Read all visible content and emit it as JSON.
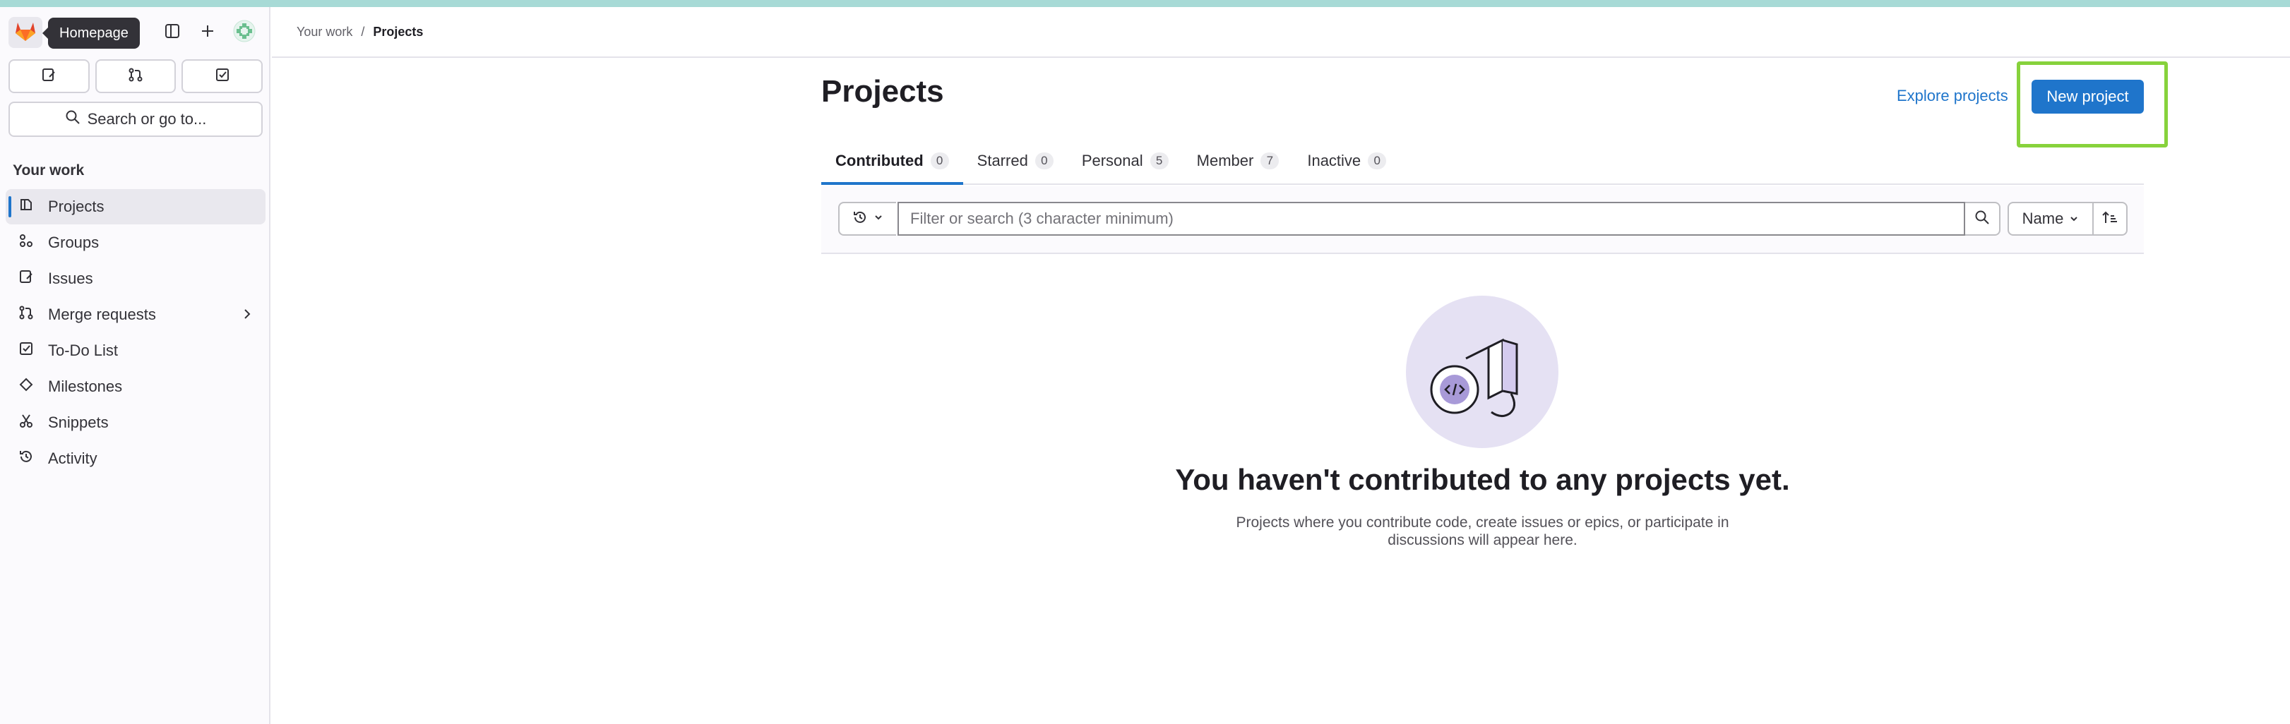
{
  "colors": {
    "accent": "#1f75cb",
    "highlight": "#87d23c",
    "top_strip": "#a7dad6",
    "illustration_bg": "#e5e1f3"
  },
  "sidebar": {
    "logo_icon": "gitlab-tanuki-icon",
    "tooltip": "Homepage",
    "top_icons": [
      "sidebar-toggle-icon",
      "plus-icon",
      "user-avatar-icon"
    ],
    "quick_actions": [
      "issues-icon",
      "merge-request-icon",
      "todo-icon"
    ],
    "search_label": "Search or go to...",
    "section_title": "Your work",
    "items": [
      {
        "label": "Projects",
        "icon": "project-icon",
        "active": true
      },
      {
        "label": "Groups",
        "icon": "group-icon"
      },
      {
        "label": "Issues",
        "icon": "issues-icon"
      },
      {
        "label": "Merge requests",
        "icon": "merge-request-icon",
        "has_chevron": true
      },
      {
        "label": "To-Do List",
        "icon": "todo-icon"
      },
      {
        "label": "Milestones",
        "icon": "milestone-icon"
      },
      {
        "label": "Snippets",
        "icon": "snippet-icon"
      },
      {
        "label": "Activity",
        "icon": "history-icon"
      }
    ]
  },
  "breadcrumb": {
    "parent": "Your work",
    "separator": "/",
    "current": "Projects"
  },
  "main": {
    "title": "Projects",
    "explore_link": "Explore projects",
    "new_project_label": "New project",
    "tabs": [
      {
        "label": "Contributed",
        "count": "0",
        "active": true
      },
      {
        "label": "Starred",
        "count": "0"
      },
      {
        "label": "Personal",
        "count": "5"
      },
      {
        "label": "Member",
        "count": "7"
      },
      {
        "label": "Inactive",
        "count": "0"
      }
    ],
    "filter_placeholder": "Filter or search (3 character minimum)",
    "sort_label": "Name",
    "empty_title": "You haven't contributed to any projects yet.",
    "empty_desc_line1": "Projects where you contribute code, create issues or epics, or participate in",
    "empty_desc_line2": "discussions will appear here."
  }
}
